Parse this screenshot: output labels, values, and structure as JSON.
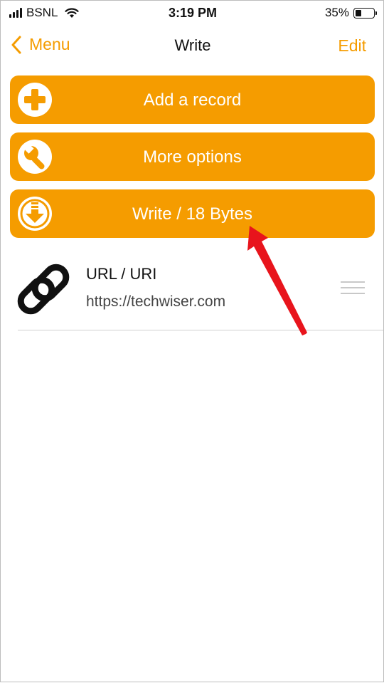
{
  "status_bar": {
    "carrier": "BSNL",
    "time": "3:19 PM",
    "battery": "35%",
    "battery_level": 0.35
  },
  "nav": {
    "back_label": "Menu",
    "title": "Write",
    "edit_label": "Edit"
  },
  "actions": [
    {
      "label": "Add a record",
      "icon": "plus-circle-icon"
    },
    {
      "label": "More options",
      "icon": "wrench-icon"
    },
    {
      "label": "Write / 18 Bytes",
      "icon": "download-arrow-icon"
    }
  ],
  "records": [
    {
      "title": "URL / URI",
      "value": "https://techwiser.com",
      "icon": "link-icon"
    }
  ],
  "colors": {
    "accent": "#f59c00",
    "annotation": "#e8141c"
  }
}
